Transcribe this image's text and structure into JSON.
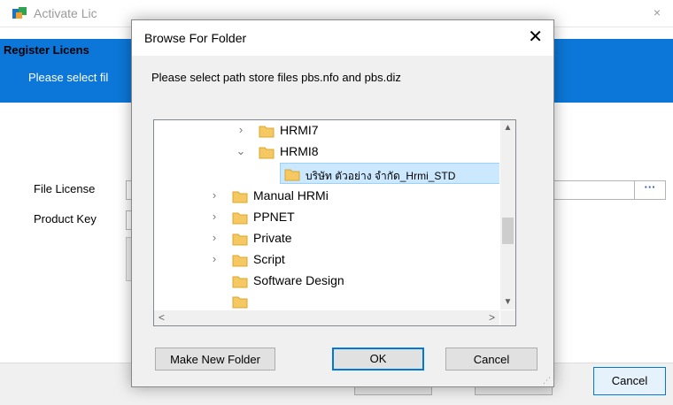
{
  "background_window": {
    "title": "Activate Lic",
    "close_glyph": "×",
    "banner_title": "Register Licens",
    "banner_subtitle": "Please select fil",
    "file_license_label": "File License",
    "product_key_label": "Product Key",
    "browse_button_label": "···",
    "back_button_label": "< Back",
    "process_button_label": "Process",
    "cancel_button_label": "Cancel"
  },
  "dialog": {
    "title": "Browse For Folder",
    "close_glyph": "✕",
    "prompt": "Please select path store files pbs.nfo and pbs.diz",
    "tree": [
      {
        "label": "HRMI7",
        "expander": "›",
        "level": 2
      },
      {
        "label": "HRMI8",
        "expander": "⌄",
        "level": 2
      },
      {
        "label": "บริษัท ตัวอย่าง จำกัด_Hrmi_STD",
        "expander": "",
        "level": 3,
        "selected": true
      },
      {
        "label": "Manual HRMi",
        "expander": "›",
        "level": 1
      },
      {
        "label": "PPNET",
        "expander": "›",
        "level": 1
      },
      {
        "label": "Private",
        "expander": "›",
        "level": 1
      },
      {
        "label": "Script",
        "expander": "›",
        "level": 1
      },
      {
        "label": "Software Design",
        "expander": "",
        "level": 1
      }
    ],
    "scroll_up_glyph": "▲",
    "scroll_down_glyph": "▼",
    "scroll_left_glyph": "<",
    "scroll_right_glyph": ">",
    "make_new_folder_label": "Make New Folder",
    "ok_label": "OK",
    "cancel_label": "Cancel"
  },
  "colors": {
    "banner": "#0c77d8",
    "selection": "#cce8ff",
    "folder": "#f5c862",
    "default_button_border": "#0078d7"
  },
  "icons": {
    "app": "app-icon",
    "folder": "folder-icon"
  }
}
